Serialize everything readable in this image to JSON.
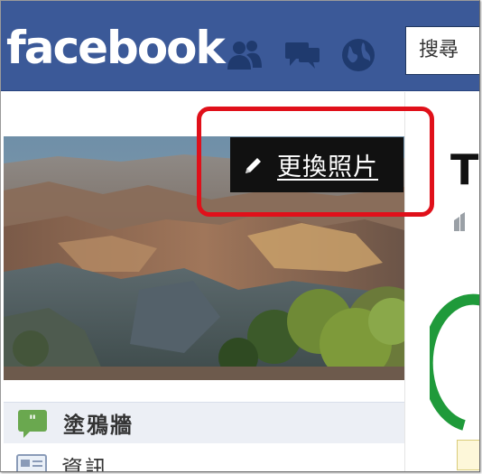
{
  "header": {
    "logo_text": "facebook",
    "search_placeholder": "搜尋",
    "icons": [
      "friends-icon",
      "messages-icon",
      "notifications-globe-icon"
    ],
    "brand_color": "#3b5998"
  },
  "cover": {
    "change_photo_label": "更換照片",
    "highlight_color": "#e0101a"
  },
  "sidebar": {
    "items": [
      {
        "label": "塗鴉牆",
        "icon": "wall-speech-icon"
      },
      {
        "label": "資訊",
        "icon": "info-card-icon"
      }
    ]
  },
  "right_column": {
    "title_fragment": "T"
  }
}
